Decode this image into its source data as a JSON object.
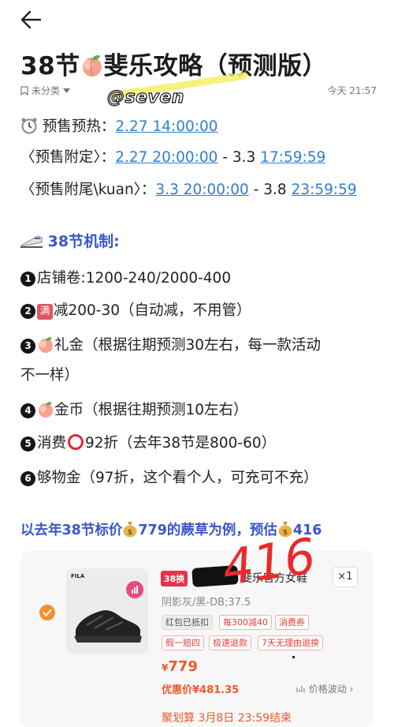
{
  "nav": {
    "back_icon": "arrow-left-icon"
  },
  "note": {
    "title_prefix": "38节",
    "title_suffix": "斐乐攻略（预测版）",
    "category": "未分类",
    "time": "今天 21:57",
    "watermark": "@seven"
  },
  "presale": {
    "warmup_label": "预售预热：",
    "warmup_time": "2.27 14:00:00",
    "deposit_label": "〈预售附定〉：",
    "deposit_start": "2.27 20:00:00",
    "deposit_sep": " - 3.3 ",
    "deposit_end": "17:59:59",
    "final_label": "〈预售附尾\\kuan〉：",
    "final_start": "3.3 20:00:00",
    "final_sep": " - 3.8 ",
    "final_end": "23:59:59"
  },
  "mechanism": {
    "title": "38节机制:",
    "items": [
      {
        "num": "1",
        "text": "店铺卷:1200-240/2000-400"
      },
      {
        "num": "2",
        "badge": "满",
        "text": "减200-30（自动减，不用管）"
      },
      {
        "num": "3",
        "text": "礼金（根据往期预测30左右，每一款活动"
      },
      {
        "num": "",
        "text": "不一样）"
      },
      {
        "num": "4",
        "text": "金币（根据往期预测10左右）"
      },
      {
        "num": "5",
        "text_a": "消费",
        "text_b": "92折（去年38节是800-60）"
      },
      {
        "num": "6",
        "text": "够物金（97折，这个看个人，可充可不充）"
      }
    ]
  },
  "example": {
    "part1": "以去年38节标价",
    "part2": "779的蕨草为例，预估",
    "part3": "416",
    "handwritten": "416"
  },
  "product": {
    "brand": "FILA",
    "badge": "38换",
    "shop": "斐乐官方女鞋",
    "qty": "×1",
    "variant": "阴影灰/黑-DB;37.5",
    "tags_row1": [
      "红包已抵扣",
      "每300减40",
      "消费券"
    ],
    "tags_row2": [
      "假一赔四",
      "极速退款",
      "7天无理由退换"
    ],
    "price_symbol": "¥",
    "price": "779",
    "promo_price": "优惠价¥481.35",
    "price_trend": "价格波动",
    "juhuasuan": "聚划算 3月8日 23:59结束"
  },
  "colors": {
    "link": "#2f7fd2",
    "section": "#3a56c7",
    "accent": "#ec5a2c"
  }
}
